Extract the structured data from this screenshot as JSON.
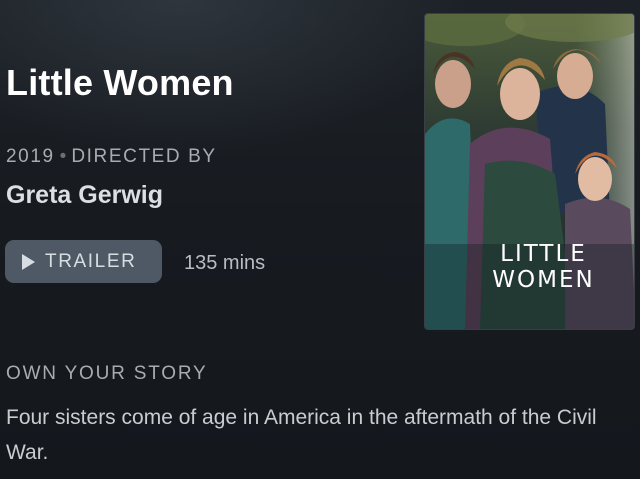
{
  "movie": {
    "title": "Little Women",
    "year": "2019",
    "meta_separator": "•",
    "directed_by_label": "DIRECTED BY",
    "director": "Greta Gerwig",
    "trailer_label": "TRAILER",
    "trailer_icon": "play-icon",
    "runtime": "135 mins",
    "tagline": "OWN YOUR STORY",
    "synopsis": "Four sisters come of age in America in the aftermath of the Civil War.",
    "poster": {
      "title_line1": "LITTLE",
      "title_line2": "WOMEN"
    }
  },
  "colors": {
    "background": "#15191e",
    "button_bg": "#4e5965",
    "meta_text": "#a7acb3"
  }
}
